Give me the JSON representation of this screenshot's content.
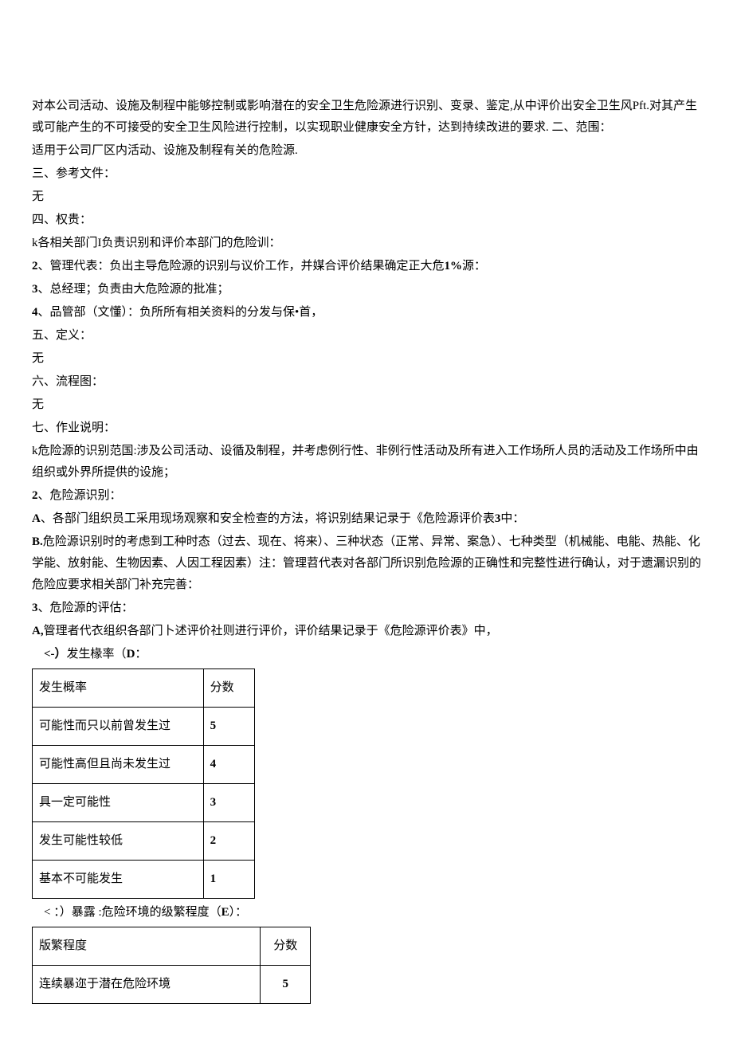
{
  "para1": "对本公司活动、设施及制程中能够控制或影响潜在的安全卫生危险源进行识别、变录、鉴定,从中评价出安全卫生风Pft.对其产生或可能产生的不可接受的安全卫生风险进行控制，以实现职业健康安全方针，达到持续改进的要求. 二、范围：",
  "para2": "适用于公司厂区内活动、设施及制程有关的危险源.",
  "para3": "三、参考文件：",
  "para4": "无",
  "para5": "四、权贵：",
  "para6": "k各相关部门I负责识别和评价本部门的危险训：",
  "para7a": "2",
  "para7b": "、管理代表：负出主导危险源的识别与议价工作，并媒合评价结果确定正大危",
  "para7c": "1%",
  "para7d": "源：",
  "para8a": "3",
  "para8b": "、总经理；负责由大危险源的批准；",
  "para9a": "4",
  "para9b": "、品管部（文懂）：负所所有相关资料的分发与保•首，",
  "para10": "五、定义：",
  "para11": "无",
  "para12": "六、流程图：",
  "para13": "无",
  "para14": "七、作业说明：",
  "para15": "k危险源的识别范国:涉及公司活动、设循及制程，并考虑例行性、非例行性活动及所有进入工作场所人员的活动及工作场所中由组织或外界所提供的设施；",
  "para16a": "2",
  "para16b": "、危险源识别：",
  "para17a": "A",
  "para17b": "、各部门组织员工采用现场观察和安全检查的方法，将识别结果记录于《危险源评价表",
  "para17c": "3",
  "para17d": "中：",
  "para18a": "B.",
  "para18b": "危险源识别时的考虑到工种时态（过去、现在、将来）、三种状态（正常、异常、案急）、七种类型（机械能、电能、热能、化学能、放射能、生物因素、人因工程因素）注：管理苕代表对各部门所识别危险源的正确性和完整性进行确认，对于遗漏识别的危险应要求相关部门补充完善：",
  "para19a": "3",
  "para19b": "、危险源的评估：",
  "para20a": "A,",
  "para20b": "管理者代衣组织各部门卜述评价社则进行评价，评价结果记录于《危险源评价表》中，",
  "para21a": "<-）",
  "para21b": "发生椽率（",
  "para21c": "D",
  "para21d": "：",
  "table1": {
    "header": {
      "c1": "发生概率",
      "c2": "分数"
    },
    "rows": [
      {
        "c1": "可能性而只以前曾发生过",
        "c2": "5"
      },
      {
        "c1": "可能性高但且尚未发生过",
        "c2": "4"
      },
      {
        "c1": "具一定可能性",
        "c2": "3"
      },
      {
        "c1": "发生可能性较低",
        "c2": "2"
      },
      {
        "c1": "基本不可能发生",
        "c2": "1"
      }
    ]
  },
  "para22a": "< ：）暴露 :危险环境的级繁程度（",
  "para22b": "E",
  "para22c": "）：",
  "table2": {
    "header": {
      "c1": "版繁程度",
      "c2": "分数"
    },
    "rows": [
      {
        "c1": "连续暴迩于潜在危险环境",
        "c2": "5"
      }
    ]
  }
}
